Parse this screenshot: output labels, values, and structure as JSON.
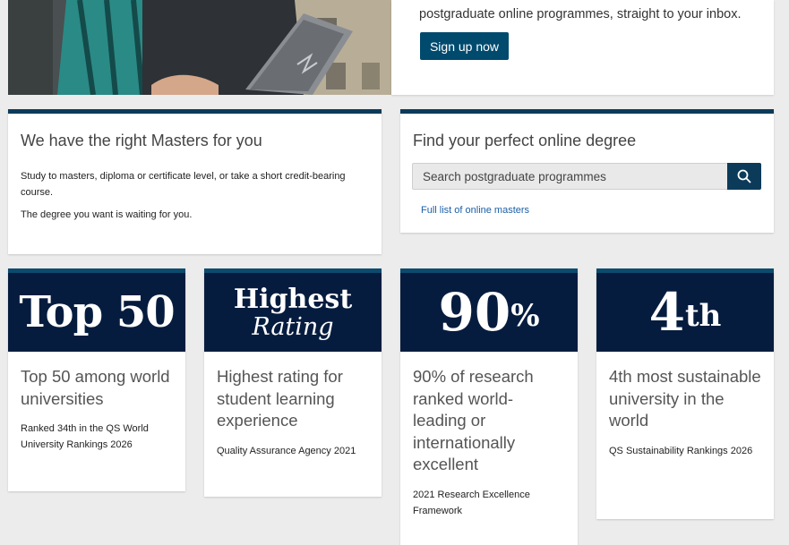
{
  "signup": {
    "text": "postgraduate online programmes, straight to your inbox.",
    "button_label": "Sign up now"
  },
  "masters": {
    "title": "We have the right Masters for you",
    "body1": "Study to masters, diploma or certificate level, or take a short credit-bearing course.",
    "body2": "The degree you want is waiting for you."
  },
  "search": {
    "title": "Find your perfect online degree",
    "placeholder": "Search postgraduate programmes",
    "link": "Full list of online masters",
    "search_icon": "search-icon"
  },
  "stats": [
    {
      "badge": "Top 50",
      "title": "Top 50 among world universities",
      "source": "Ranked 34th in the QS World University Rankings 2026"
    },
    {
      "badge_line1": "Highest",
      "badge_line2": "Rating",
      "title": "Highest rating for student learning experience",
      "source": "Quality Assurance Agency 2021"
    },
    {
      "badge_main": "90",
      "badge_sup": "%",
      "title": "90% of research ranked world-leading or internationally excellent",
      "source": "2021 Research Excellence Framework"
    },
    {
      "badge_main": "4",
      "badge_sup": "th",
      "title": "4th most sustainable university in the world",
      "source": "QS Sustainability Rankings 2026"
    }
  ],
  "colors": {
    "accent": "#004a6e",
    "badge_bg": "#061c3f",
    "link": "#1a5fa8"
  }
}
